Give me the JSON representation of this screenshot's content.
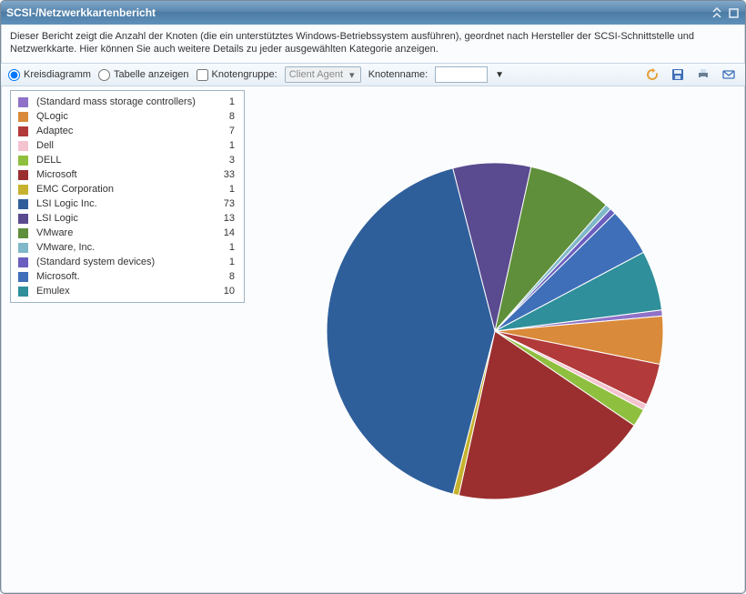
{
  "window": {
    "title": "SCSI-/Netzwerkkartenbericht"
  },
  "description": "Dieser Bericht zeigt die Anzahl der Knoten (die ein unterstütztes Windows-Betriebssystem ausführen), geordnet nach Hersteller der SCSI-Schnittstelle und Netzwerkkarte. Hier können Sie auch weitere Details zu jeder ausgewählten Kategorie anzeigen.",
  "toolbar": {
    "view_piechart": "Kreisdiagramm",
    "view_table": "Tabelle anzeigen",
    "nodegroup_label": "Knotengruppe:",
    "nodegroup_value": "Client Agent",
    "nodename_label": "Knotenname:",
    "nodename_value": ""
  },
  "chart_data": {
    "type": "pie",
    "title": "",
    "series": [
      {
        "name": "(Standard mass storage controllers)",
        "value": 1,
        "color": "#8f72c8"
      },
      {
        "name": "QLogic",
        "value": 8,
        "color": "#d98a3a"
      },
      {
        "name": "Adaptec",
        "value": 7,
        "color": "#b23a3a"
      },
      {
        "name": "Dell",
        "value": 1,
        "color": "#f4c3d0"
      },
      {
        "name": "DELL",
        "value": 3,
        "color": "#8fbf3f"
      },
      {
        "name": "Microsoft",
        "value": 33,
        "color": "#9b2f2f"
      },
      {
        "name": "EMC Corporation",
        "value": 1,
        "color": "#c6b22f"
      },
      {
        "name": "LSI Logic Inc.",
        "value": 73,
        "color": "#2f5f9b"
      },
      {
        "name": "LSI Logic",
        "value": 13,
        "color": "#5a4a8f"
      },
      {
        "name": "VMware",
        "value": 14,
        "color": "#5f8f3a"
      },
      {
        "name": "VMware, Inc.",
        "value": 1,
        "color": "#7fb8c8"
      },
      {
        "name": "(Standard system devices)",
        "value": 1,
        "color": "#6a5fbf"
      },
      {
        "name": "Microsoft.",
        "value": 8,
        "color": "#3f6fb8"
      },
      {
        "name": "Emulex",
        "value": 10,
        "color": "#2f8f9b"
      }
    ]
  }
}
